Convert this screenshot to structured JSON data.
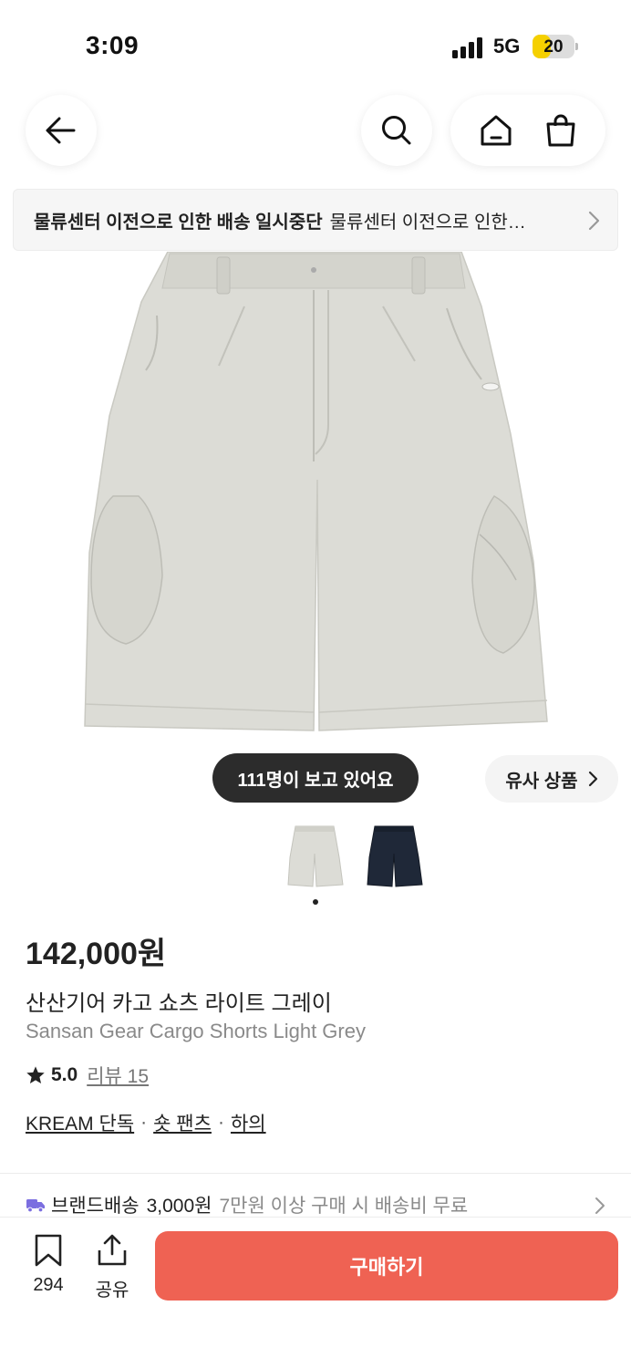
{
  "status_bar": {
    "time": "3:09",
    "network": "5G",
    "battery_percent": "20"
  },
  "nav": {
    "back_icon": "arrow-left-icon",
    "search_icon": "search-icon",
    "home_icon": "home-icon",
    "bag_icon": "shopping-bag-icon"
  },
  "notice": {
    "title": "물류센터 이전으로 인한 배송 일시중단",
    "text": "물류센터 이전으로 인한…"
  },
  "gallery": {
    "viewers_text": "111명이 보고 있어요",
    "similar_label": "유사 상품",
    "page_count": 1,
    "thumbnails": [
      "light-grey",
      "navy"
    ]
  },
  "product": {
    "price": "142,000원",
    "name_ko": "산산기어 카고 쇼츠 라이트 그레이",
    "name_en": "Sansan Gear Cargo Shorts Light Grey",
    "rating": "5.0",
    "review_label": "리뷰 15",
    "categories": [
      "KREAM 단독",
      "숏 팬츠",
      "하의"
    ],
    "category_separator": "·"
  },
  "shipping": {
    "label": "브랜드배송",
    "fee": "3,000원",
    "note": "7만원 이상 구매 시 배송비 무료"
  },
  "bottom_bar": {
    "wish_count": "294",
    "share_label": "공유",
    "buy_label": "구매하기"
  },
  "colors": {
    "buy_button": "#ef6253",
    "battery": "#f5d000",
    "shipping_truck": "#7b6ee0",
    "shorts_grey": "#dcdcd6",
    "shorts_navy": "#1f2838"
  }
}
